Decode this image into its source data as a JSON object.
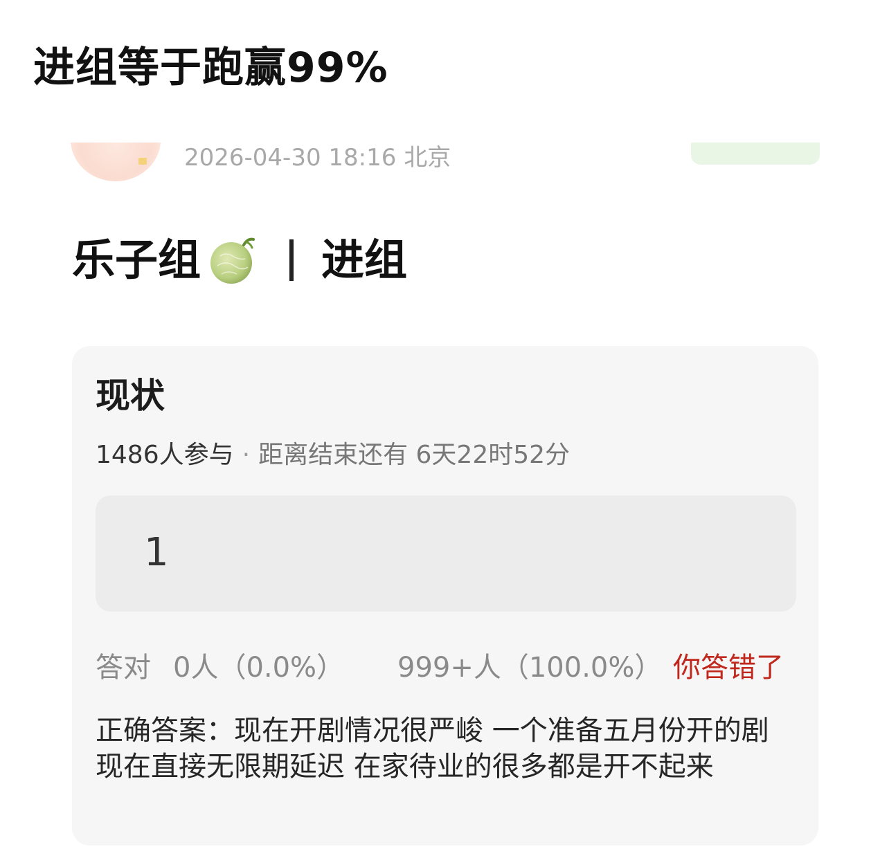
{
  "header": {
    "title": "进组等于跑赢99%"
  },
  "post": {
    "meta": "2026-04-30 18:16  北京",
    "heading_left": "乐子组",
    "heading_right": "进组",
    "heading_icon": "melon-icon"
  },
  "poll": {
    "title": "现状",
    "participants": "1486人参与",
    "separator": "·",
    "remaining": "距离结束还有 6天22时52分",
    "option_label": "1",
    "correct_label": "答对",
    "correct_count": "0人（0.0%）",
    "wrong_count": "999+人（100.0%）",
    "wrong_badge": "你答错了",
    "answer_text": "正确答案：现在开剧情况很严峻 一个准备五月份开的剧现在直接无限期延迟 在家待业的很多都是开不起来"
  },
  "colors": {
    "wrong": "#c0281e",
    "card_bg": "#f6f6f6",
    "option_bg": "#ececec",
    "follow_bg": "#e9f6e6",
    "muted_text": "#8a8a8a"
  }
}
